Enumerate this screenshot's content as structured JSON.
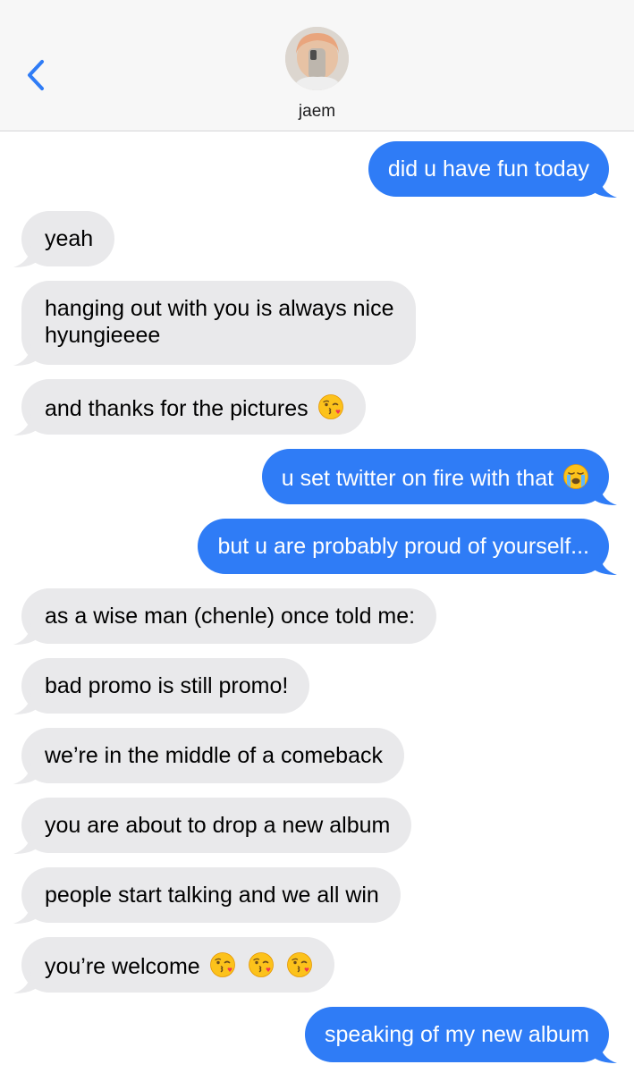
{
  "contact": {
    "name": "jaem"
  },
  "colors": {
    "outgoing": "#2f7cf6",
    "incoming": "#e9e9eb",
    "accent": "#2f7cf6"
  },
  "messages": [
    {
      "from": "me",
      "text": "did u have fun today"
    },
    {
      "from": "contact",
      "text": "yeah"
    },
    {
      "from": "contact",
      "line1": "hanging out with you is always nice",
      "line2": "hyungieeee"
    },
    {
      "from": "contact",
      "text": "and thanks for the pictures",
      "emoji": "kissing-heart-emoji"
    },
    {
      "from": "me",
      "text": "u set twitter on fire with that",
      "emoji": "loudly-crying-emoji"
    },
    {
      "from": "me",
      "text": "but u are probably proud of yourself..."
    },
    {
      "from": "contact",
      "text": "as a wise man (chenle) once told me:"
    },
    {
      "from": "contact",
      "text": "bad promo is still promo!"
    },
    {
      "from": "contact",
      "text": "we’re in the middle of a comeback"
    },
    {
      "from": "contact",
      "text": "you are about to drop a new album"
    },
    {
      "from": "contact",
      "text": "people start talking and we all win"
    },
    {
      "from": "contact",
      "text": "you’re welcome",
      "emoji": "kissing-heart-emoji x3"
    },
    {
      "from": "me",
      "text": "speaking of my new album"
    }
  ]
}
